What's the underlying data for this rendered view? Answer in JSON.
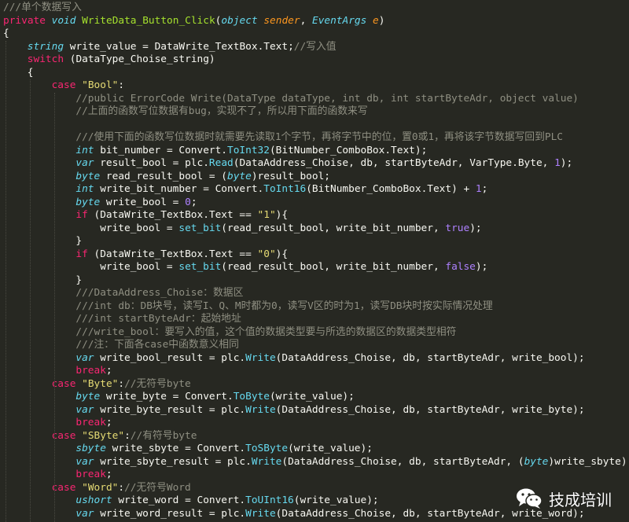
{
  "editor": {
    "lines": [
      {
        "indent": 0,
        "tokens": [
          [
            "cm",
            "///单个数据写入"
          ]
        ]
      },
      {
        "indent": 0,
        "tokens": [
          [
            "kw",
            "private "
          ],
          [
            "ty",
            "void "
          ],
          [
            "fn",
            "WriteData_Button_Click"
          ],
          [
            "pl",
            "("
          ],
          [
            "ty",
            "object "
          ],
          [
            "ar",
            "sender"
          ],
          [
            "pl",
            ", "
          ],
          [
            "ty",
            "EventArgs "
          ],
          [
            "ar",
            "e"
          ],
          [
            "pl",
            ")"
          ]
        ]
      },
      {
        "indent": 0,
        "tokens": [
          [
            "pl",
            "{"
          ]
        ]
      },
      {
        "indent": 1,
        "tokens": [
          [
            "ty",
            "string "
          ],
          [
            "pl",
            "write_value = DataWrite_TextBox.Text;"
          ],
          [
            "cm",
            "//写入值"
          ]
        ]
      },
      {
        "indent": 1,
        "tokens": [
          [
            "kw",
            "switch "
          ],
          [
            "pl",
            "(DataType_Choise_string)"
          ]
        ]
      },
      {
        "indent": 1,
        "tokens": [
          [
            "pl",
            "{"
          ]
        ]
      },
      {
        "indent": 2,
        "tokens": [
          [
            "kw",
            "case "
          ],
          [
            "st",
            "\"Bool\""
          ],
          [
            "pl",
            ":"
          ]
        ]
      },
      {
        "indent": 3,
        "tokens": [
          [
            "cm",
            "//public ErrorCode Write(DataType dataType, int db, int startByteAdr, object value)"
          ]
        ]
      },
      {
        "indent": 3,
        "tokens": [
          [
            "cm",
            "//上面的函数写位数据有bug，实现不了，所以用下面的函数来写"
          ]
        ]
      },
      {
        "indent": 0,
        "tokens": []
      },
      {
        "indent": 3,
        "tokens": [
          [
            "cm",
            "///使用下面的函数写位数据时就需要先读取1个字节，再将字节中的位，置0或1，再将该字节数据写回到PLC"
          ]
        ]
      },
      {
        "indent": 3,
        "tokens": [
          [
            "ty",
            "int "
          ],
          [
            "pl",
            "bit_number = Convert."
          ],
          [
            "meth",
            "ToInt32"
          ],
          [
            "pl",
            "(BitNumber_ComboBox.Text);"
          ]
        ]
      },
      {
        "indent": 3,
        "tokens": [
          [
            "ty",
            "var "
          ],
          [
            "pl",
            "result_bool = plc."
          ],
          [
            "meth",
            "Read"
          ],
          [
            "pl",
            "(DataAddress_Choise, db, startByteAdr, VarType.Byte, "
          ],
          [
            "nm",
            "1"
          ],
          [
            "pl",
            ");"
          ]
        ]
      },
      {
        "indent": 3,
        "tokens": [
          [
            "ty",
            "byte "
          ],
          [
            "pl",
            "read_result_bool = ("
          ],
          [
            "ty",
            "byte"
          ],
          [
            "pl",
            ")result_bool;"
          ]
        ]
      },
      {
        "indent": 3,
        "tokens": [
          [
            "ty",
            "int "
          ],
          [
            "pl",
            "write_bit_number = Convert."
          ],
          [
            "meth",
            "ToInt16"
          ],
          [
            "pl",
            "(BitNumber_ComboBox.Text) + "
          ],
          [
            "nm",
            "1"
          ],
          [
            "pl",
            ";"
          ]
        ]
      },
      {
        "indent": 3,
        "tokens": [
          [
            "ty",
            "byte "
          ],
          [
            "pl",
            "write_bool = "
          ],
          [
            "nm",
            "0"
          ],
          [
            "pl",
            ";"
          ]
        ]
      },
      {
        "indent": 3,
        "tokens": [
          [
            "kw",
            "if "
          ],
          [
            "pl",
            "(DataWrite_TextBox.Text == "
          ],
          [
            "st",
            "\"1\""
          ],
          [
            "pl",
            "){"
          ]
        ]
      },
      {
        "indent": 4,
        "tokens": [
          [
            "pl",
            "write_bool = "
          ],
          [
            "meth",
            "set_bit"
          ],
          [
            "pl",
            "(read_result_bool, write_bit_number, "
          ],
          [
            "nm",
            "true"
          ],
          [
            "pl",
            ");"
          ]
        ]
      },
      {
        "indent": 3,
        "tokens": [
          [
            "pl",
            "}"
          ]
        ]
      },
      {
        "indent": 3,
        "tokens": [
          [
            "kw",
            "if "
          ],
          [
            "pl",
            "(DataWrite_TextBox.Text == "
          ],
          [
            "st",
            "\"0\""
          ],
          [
            "pl",
            "){"
          ]
        ]
      },
      {
        "indent": 4,
        "tokens": [
          [
            "pl",
            "write_bool = "
          ],
          [
            "meth",
            "set_bit"
          ],
          [
            "pl",
            "(read_result_bool, write_bit_number, "
          ],
          [
            "nm",
            "false"
          ],
          [
            "pl",
            ");"
          ]
        ]
      },
      {
        "indent": 3,
        "tokens": [
          [
            "pl",
            "}"
          ]
        ]
      },
      {
        "indent": 3,
        "tokens": [
          [
            "cm",
            "///DataAddress_Choise：数据区"
          ]
        ]
      },
      {
        "indent": 3,
        "tokens": [
          [
            "cm",
            "///int db：DB块号，读写I、Q、M时都为0，读写V区的时为1，读写DB块时按实际情况处理"
          ]
        ]
      },
      {
        "indent": 3,
        "tokens": [
          [
            "cm",
            "///int startByteAdr：起始地址"
          ]
        ]
      },
      {
        "indent": 3,
        "tokens": [
          [
            "cm",
            "///write_bool：要写入的值，这个值的数据类型要与所选的数据区的数据类型相符"
          ]
        ]
      },
      {
        "indent": 3,
        "tokens": [
          [
            "cm",
            "///注：下面各case中函数意义相同"
          ]
        ]
      },
      {
        "indent": 3,
        "tokens": [
          [
            "ty",
            "var "
          ],
          [
            "pl",
            "write_bool_result = plc."
          ],
          [
            "meth",
            "Write"
          ],
          [
            "pl",
            "(DataAddress_Choise, db, startByteAdr, write_bool);"
          ]
        ]
      },
      {
        "indent": 3,
        "tokens": [
          [
            "kw",
            "break"
          ],
          [
            "pl",
            ";"
          ]
        ]
      },
      {
        "indent": 2,
        "tokens": [
          [
            "kw",
            "case "
          ],
          [
            "st",
            "\"Byte\""
          ],
          [
            "pl",
            ":"
          ],
          [
            "cm",
            "//无符号byte"
          ]
        ]
      },
      {
        "indent": 3,
        "tokens": [
          [
            "ty",
            "byte "
          ],
          [
            "pl",
            "write_byte = Convert."
          ],
          [
            "meth",
            "ToByte"
          ],
          [
            "pl",
            "(write_value);"
          ]
        ]
      },
      {
        "indent": 3,
        "tokens": [
          [
            "ty",
            "var "
          ],
          [
            "pl",
            "write_byte_result = plc."
          ],
          [
            "meth",
            "Write"
          ],
          [
            "pl",
            "(DataAddress_Choise, db, startByteAdr, write_byte);"
          ]
        ]
      },
      {
        "indent": 3,
        "tokens": [
          [
            "kw",
            "break"
          ],
          [
            "pl",
            ";"
          ]
        ]
      },
      {
        "indent": 2,
        "tokens": [
          [
            "kw",
            "case "
          ],
          [
            "st",
            "\"SByte\""
          ],
          [
            "pl",
            ":"
          ],
          [
            "cm",
            "//有符号byte"
          ]
        ]
      },
      {
        "indent": 3,
        "tokens": [
          [
            "ty",
            "sbyte "
          ],
          [
            "pl",
            "write_sbyte = Convert."
          ],
          [
            "meth",
            "ToSByte"
          ],
          [
            "pl",
            "(write_value);"
          ]
        ]
      },
      {
        "indent": 3,
        "tokens": [
          [
            "ty",
            "var "
          ],
          [
            "pl",
            "write_sbyte_result = plc."
          ],
          [
            "meth",
            "Write"
          ],
          [
            "pl",
            "(DataAddress_Choise, db, startByteAdr, ("
          ],
          [
            "ty",
            "byte"
          ],
          [
            "pl",
            ")write_sbyte);"
          ]
        ]
      },
      {
        "indent": 3,
        "tokens": [
          [
            "kw",
            "break"
          ],
          [
            "pl",
            ";"
          ]
        ]
      },
      {
        "indent": 2,
        "tokens": [
          [
            "kw",
            "case "
          ],
          [
            "st",
            "\"Word\""
          ],
          [
            "pl",
            ":"
          ],
          [
            "cm",
            "//无符号Word"
          ]
        ]
      },
      {
        "indent": 3,
        "tokens": [
          [
            "ty",
            "ushort "
          ],
          [
            "pl",
            "write_word = Convert."
          ],
          [
            "meth",
            "ToUInt16"
          ],
          [
            "pl",
            "(write_value);"
          ]
        ]
      },
      {
        "indent": 3,
        "tokens": [
          [
            "ty",
            "var "
          ],
          [
            "pl",
            "write_word_result = plc."
          ],
          [
            "meth",
            "Write"
          ],
          [
            "pl",
            "(DataAddress_Choise, db, startByteAdr, write_word);"
          ]
        ]
      }
    ]
  },
  "watermark": {
    "text": "技成培训",
    "icon": "wechat-icon"
  }
}
